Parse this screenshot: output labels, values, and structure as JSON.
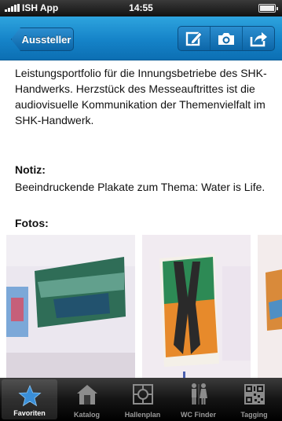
{
  "status_bar": {
    "carrier": "ISH App",
    "time": "14:55",
    "battery_level": 1.0
  },
  "nav": {
    "back_label": "Aussteller",
    "actions": [
      {
        "name": "edit-icon"
      },
      {
        "name": "camera-icon"
      },
      {
        "name": "share-icon"
      }
    ]
  },
  "content": {
    "description": "Leistungsportfolio für die Innungsbetriebe des SHK-Handwerks. Herzstück des Messeauftrittes ist die audiovisuelle Kommunikation der Themenvielfalt im SHK-Handwerk.",
    "note_title": "Notiz:",
    "note_text": "Beeindruckende Plakate zum Thema: Water is Life.",
    "photos_title": "Fotos:"
  },
  "tabs": [
    {
      "label": "Favoriten",
      "icon": "star-icon",
      "active": true
    },
    {
      "label": "Katalog",
      "icon": "house-icon",
      "active": false
    },
    {
      "label": "Hallenplan",
      "icon": "floorplan-icon",
      "active": false
    },
    {
      "label": "WC Finder",
      "icon": "restroom-icon",
      "active": false
    },
    {
      "label": "Tagging",
      "icon": "qr-code-icon",
      "active": false
    }
  ],
  "colors": {
    "nav_blue": "#1583c8",
    "tab_active_star": "#3a8fd9"
  }
}
